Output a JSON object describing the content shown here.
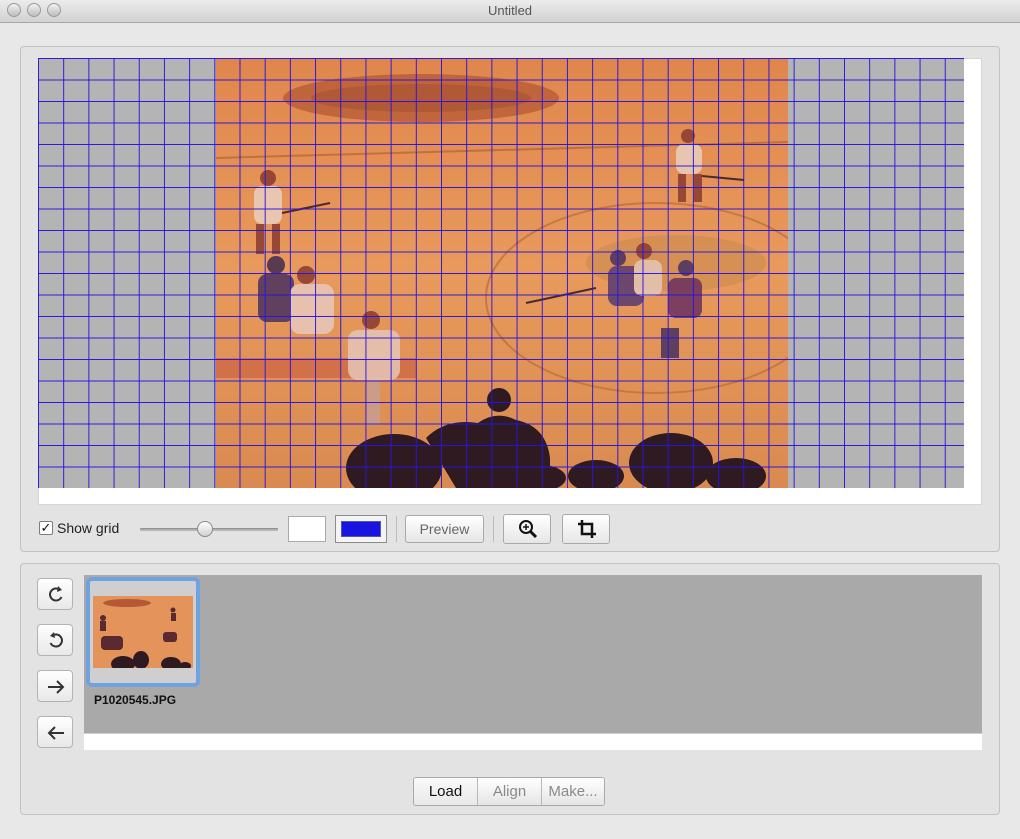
{
  "window": {
    "title": "Untitled"
  },
  "controls": {
    "show_grid_label": "Show grid",
    "show_grid_checked": true,
    "grid_size_level": 0.47,
    "background_color": "#ffffff",
    "grid_color": "#1a14e0",
    "preview_label": "Preview",
    "zoom_icon": "zoom-in-icon",
    "crop_icon": "crop-icon"
  },
  "side_tools": [
    {
      "icon": "rotate-clockwise-icon"
    },
    {
      "icon": "rotate-counterclockwise-icon"
    },
    {
      "icon": "arrow-right-icon"
    },
    {
      "icon": "arrow-left-icon"
    }
  ],
  "filmstrip": {
    "items": [
      {
        "filename": "P1020545.JPG",
        "selected": true
      }
    ]
  },
  "bottom_bar": {
    "tabs": [
      {
        "label": "Load",
        "active": true
      },
      {
        "label": "Align",
        "active": false
      },
      {
        "label": "Make...",
        "active": false
      }
    ]
  }
}
